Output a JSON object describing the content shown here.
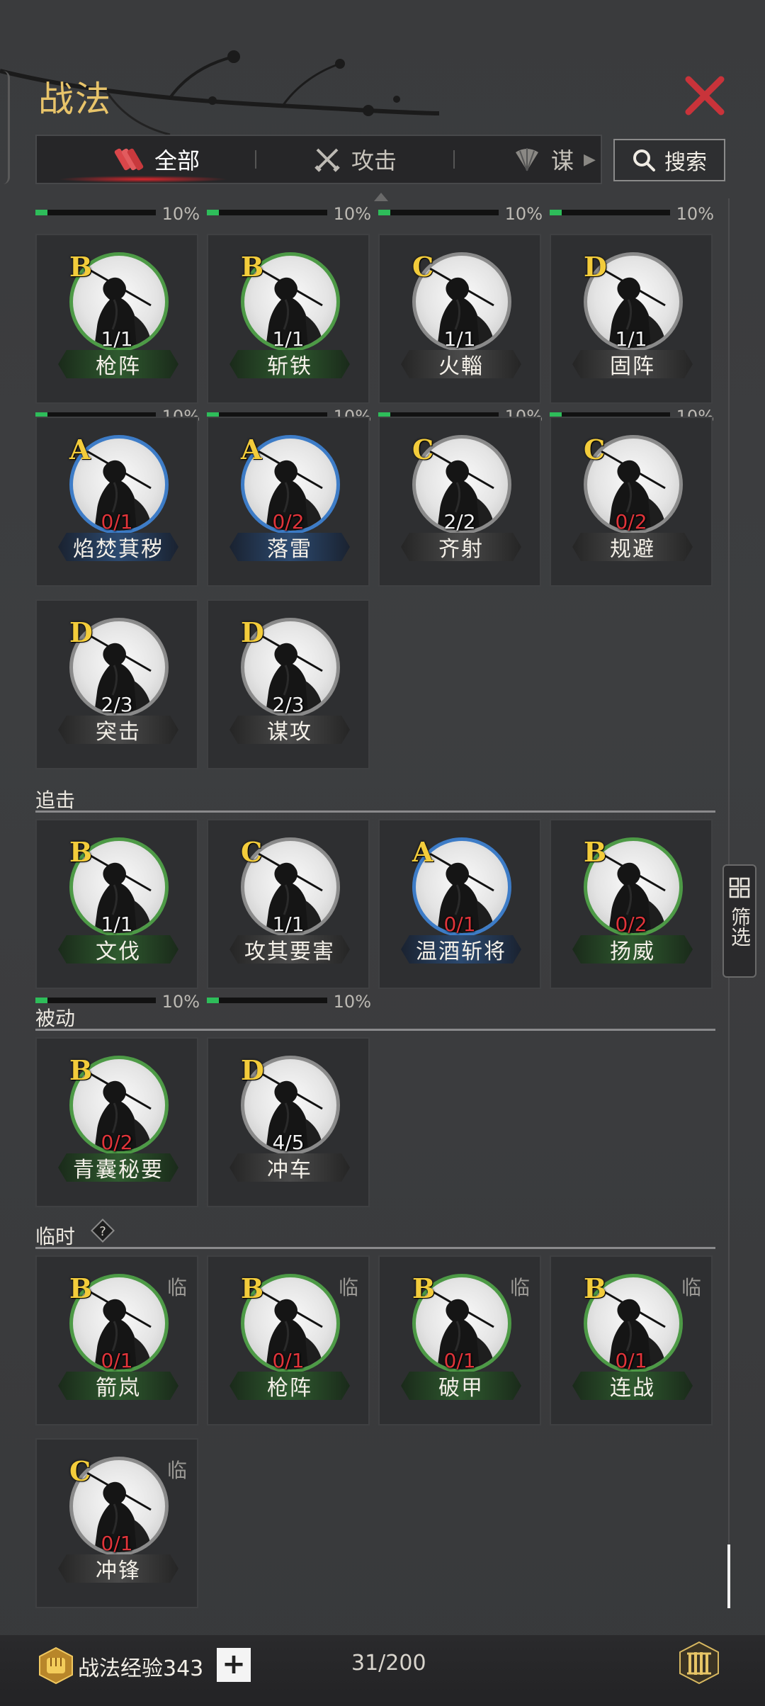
{
  "header": {
    "title": "战法",
    "tabs": [
      {
        "label": "全部",
        "icon": "scroll-bundle-icon"
      },
      {
        "label": "攻击",
        "icon": "crossed-swords-icon"
      },
      {
        "label": "谋",
        "icon": "fan-icon"
      }
    ],
    "search_label": "搜索"
  },
  "filter_label": "筛选",
  "top_progress": [
    "10%",
    "10%",
    "10%",
    "10%"
  ],
  "row1": [
    {
      "grade": "B",
      "count": "1/1",
      "name": "枪阵",
      "rarity": "green",
      "progress": "10%",
      "fill": 0.1
    },
    {
      "grade": "B",
      "count": "1/1",
      "name": "斩铁",
      "rarity": "green",
      "progress": "10%",
      "fill": 0.1
    },
    {
      "grade": "C",
      "count": "1/1",
      "name": "火輜",
      "rarity": "gray",
      "progress": "10%",
      "fill": 0.1
    },
    {
      "grade": "D",
      "count": "1/1",
      "name": "固阵",
      "rarity": "gray",
      "progress": "10%",
      "fill": 0.1
    }
  ],
  "row2": [
    {
      "grade": "A",
      "count": "0/1",
      "name": "焰焚萁秽",
      "rarity": "blue"
    },
    {
      "grade": "A",
      "count": "0/2",
      "name": "落雷",
      "rarity": "blue"
    },
    {
      "grade": "C",
      "count": "2/2",
      "name": "齐射",
      "rarity": "gray"
    },
    {
      "grade": "C",
      "count": "0/2",
      "name": "规避",
      "rarity": "gray"
    }
  ],
  "row3": [
    {
      "grade": "D",
      "count": "2/3",
      "name": "突击",
      "rarity": "gray"
    },
    {
      "grade": "D",
      "count": "2/3",
      "name": "谋攻",
      "rarity": "gray"
    }
  ],
  "section_pursuit": "追击",
  "pursuit": [
    {
      "grade": "B",
      "count": "1/1",
      "name": "文伐",
      "rarity": "green",
      "progress": "10%",
      "fill": 0.1
    },
    {
      "grade": "C",
      "count": "1/1",
      "name": "攻其要害",
      "rarity": "gray",
      "progress": "10%",
      "fill": 0.1
    },
    {
      "grade": "A",
      "count": "0/1",
      "name": "温酒斩将",
      "rarity": "blue"
    },
    {
      "grade": "B",
      "count": "0/2",
      "name": "扬威",
      "rarity": "green"
    }
  ],
  "section_passive": "被动",
  "passive": [
    {
      "grade": "B",
      "count": "0/2",
      "name": "青囊秘要",
      "rarity": "green"
    },
    {
      "grade": "D",
      "count": "4/5",
      "name": "冲车",
      "rarity": "gray"
    }
  ],
  "section_temp": "临时",
  "temp_tag": "临",
  "temp": [
    {
      "grade": "B",
      "count": "0/1",
      "name": "箭岚",
      "rarity": "green"
    },
    {
      "grade": "B",
      "count": "0/1",
      "name": "枪阵",
      "rarity": "green"
    },
    {
      "grade": "B",
      "count": "0/1",
      "name": "破甲",
      "rarity": "green"
    },
    {
      "grade": "B",
      "count": "0/1",
      "name": "连战",
      "rarity": "green"
    },
    {
      "grade": "C",
      "count": "0/1",
      "name": "冲锋",
      "rarity": "gray"
    }
  ],
  "footer": {
    "exp_label": "战法经验343",
    "plus": "+",
    "capacity": "31/200"
  }
}
